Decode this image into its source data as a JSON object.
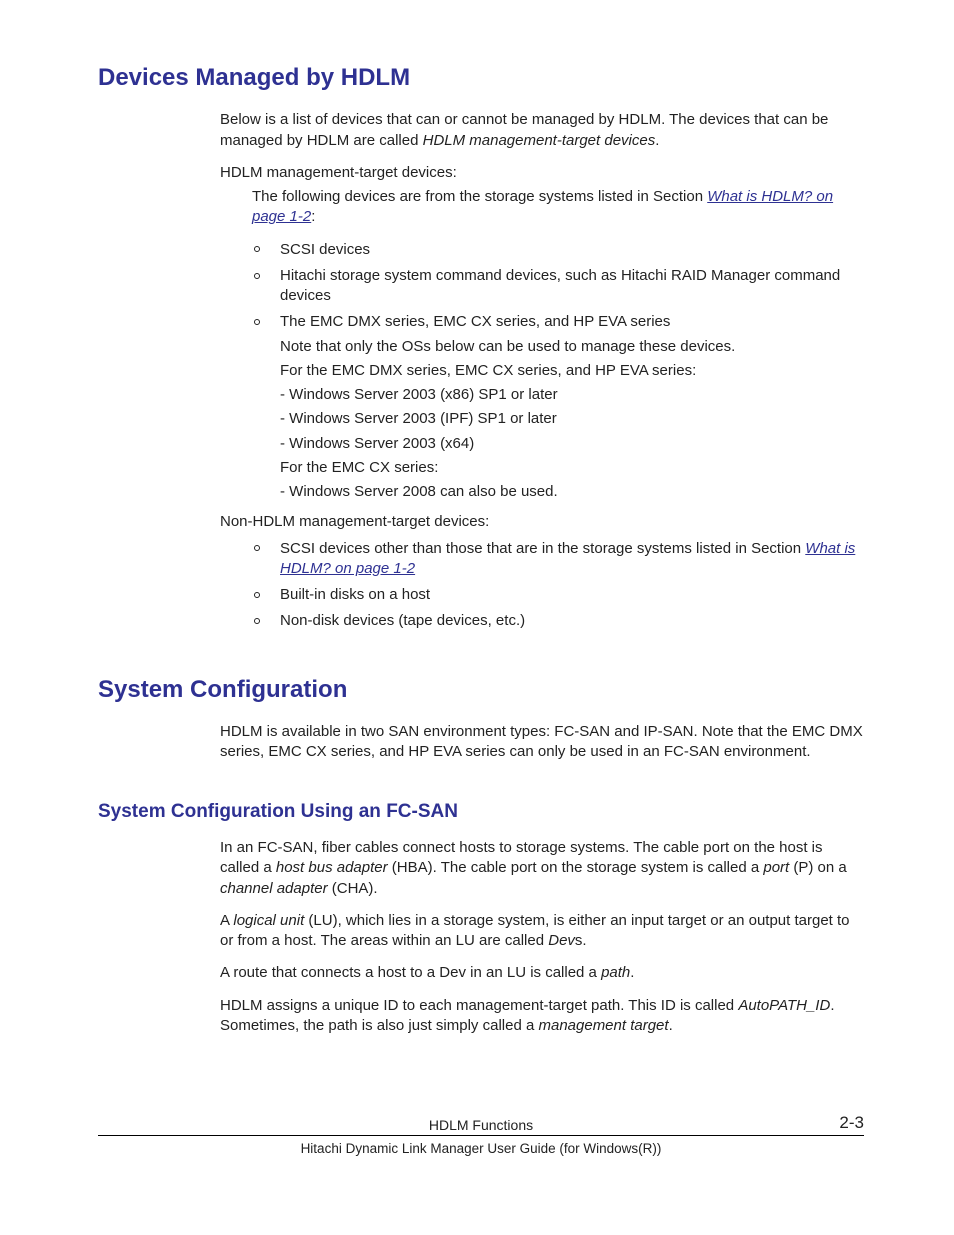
{
  "h1_devices": "Devices Managed by HDLM",
  "p_intro_a": "Below is a list of devices that can or cannot be managed by HDLM. The devices that can be managed by HDLM are called ",
  "p_intro_em": "HDLM management-target devices",
  "p_intro_b": ".",
  "p_mgmt_label": "HDLM management-target devices:",
  "p_mgmt_lead_a": "The following devices are from the storage systems listed in Section ",
  "link_what": "What is HDLM? on page 1-2",
  "p_mgmt_lead_b": ":",
  "li_scsi": "SCSI devices",
  "li_hitachi": "Hitachi storage system command devices, such as Hitachi RAID Manager command devices",
  "li_emc_top": "The EMC DMX series, EMC CX series, and HP EVA series",
  "li_emc_note": "Note that only the OSs below can be used to manage these devices.",
  "li_emc_for": "For the EMC DMX series, EMC CX series, and HP EVA series:",
  "li_emc_os1": "- Windows Server 2003 (x86) SP1 or later",
  "li_emc_os2": "- Windows Server 2003 (IPF) SP1 or later",
  "li_emc_os3": "- Windows Server 2003 (x64)",
  "li_emc_cx": "For the EMC CX series:",
  "li_emc_cx_os": "- Windows Server 2008 can also be used.",
  "p_nonmgmt_label": "Non-HDLM management-target devices:",
  "li_non_scsi_a": "SCSI devices other than those that are in the storage systems listed in Section ",
  "li_builtin": "Built-in disks on a host",
  "li_nondisk": "Non-disk devices (tape devices, etc.)",
  "h1_sysconf": "System Configuration",
  "p_sysconf": "HDLM is available in two SAN environment types: FC-SAN and IP-SAN. Note that the EMC DMX series, EMC CX series, and HP EVA series can only be used in an FC-SAN environment.",
  "h2_fc": "System Configuration Using an FC-SAN",
  "p_fc1_a": "In an FC-SAN, fiber cables connect hosts to storage systems. The cable port on the host is called a ",
  "p_fc1_em1": "host bus adapter",
  "p_fc1_b": " (HBA). The cable port on the storage system is called a ",
  "p_fc1_em2": "port",
  "p_fc1_c": " (P) on a ",
  "p_fc1_em3": "channel adapter",
  "p_fc1_d": " (CHA).",
  "p_fc2_a": "A ",
  "p_fc2_em1": "logical unit",
  "p_fc2_b": " (LU), which lies in a storage system, is either an input target or an output target to or from a host. The areas within an LU are called ",
  "p_fc2_em2": "Dev",
  "p_fc2_c": "s.",
  "p_fc3_a": "A route that connects a host to a Dev in an LU is called a ",
  "p_fc3_em": "path",
  "p_fc3_b": ".",
  "p_fc4_a": "HDLM assigns a unique ID to each management-target path. This ID is called ",
  "p_fc4_em1": "AutoPATH_ID",
  "p_fc4_b": ". Sometimes, the path is also just simply called a ",
  "p_fc4_em2": "management target",
  "p_fc4_c": ".",
  "footer_title": "HDLM Functions",
  "footer_page": "2-3",
  "footer_sub": "Hitachi Dynamic Link Manager User Guide (for Windows(R))"
}
